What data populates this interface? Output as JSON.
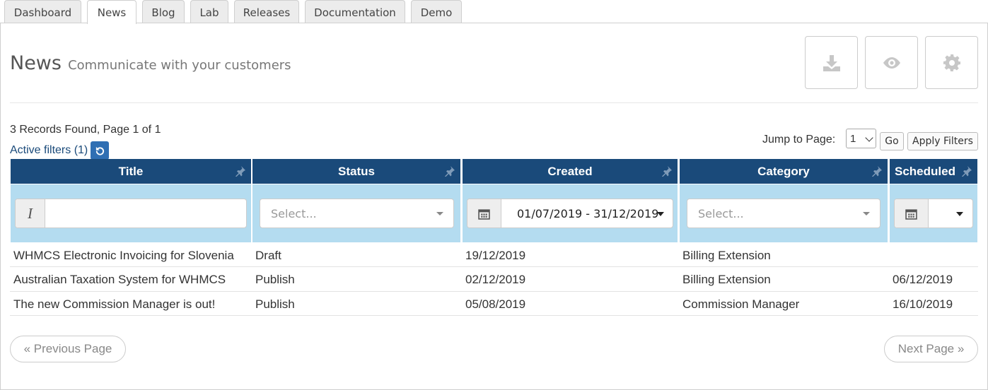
{
  "tabs": [
    {
      "label": "Dashboard"
    },
    {
      "label": "News"
    },
    {
      "label": "Blog"
    },
    {
      "label": "Lab"
    },
    {
      "label": "Releases"
    },
    {
      "label": "Documentation"
    },
    {
      "label": "Demo"
    }
  ],
  "active_tab": "News",
  "header": {
    "title": "News",
    "subtitle": "Communicate with your customers",
    "tools": [
      "download-icon",
      "eye-icon",
      "gear-icon"
    ]
  },
  "summary": {
    "records": "3 Records Found, Page 1 of 1",
    "active_filters": "Active filters (1)"
  },
  "pagination": {
    "jump_label": "Jump to Page:",
    "page_value": "1",
    "go_label": "Go",
    "apply_label": "Apply Filters",
    "prev_label": "« Previous Page",
    "next_label": "Next Page »"
  },
  "grid": {
    "columns": [
      "Title",
      "Status",
      "Created",
      "Category",
      "Scheduled"
    ],
    "filters": {
      "status_placeholder": "Select...",
      "created_range": "01/07/2019 - 31/12/2019",
      "category_placeholder": "Select..."
    },
    "rows": [
      {
        "title": "WHMCS Electronic Invoicing for Slovenia",
        "status": "Draft",
        "created": "19/12/2019",
        "category": "Billing Extension",
        "scheduled": ""
      },
      {
        "title": "Australian Taxation System for WHMCS",
        "status": "Publish",
        "created": "02/12/2019",
        "category": "Billing Extension",
        "scheduled": "06/12/2019"
      },
      {
        "title": "The new Commission Manager is out!",
        "status": "Publish",
        "created": "05/08/2019",
        "category": "Commission Manager",
        "scheduled": "16/10/2019"
      }
    ]
  },
  "colors": {
    "header_bg": "#1a4a7a",
    "filter_bg": "#b4dcf0",
    "accent_button": "#2f6fb3"
  }
}
